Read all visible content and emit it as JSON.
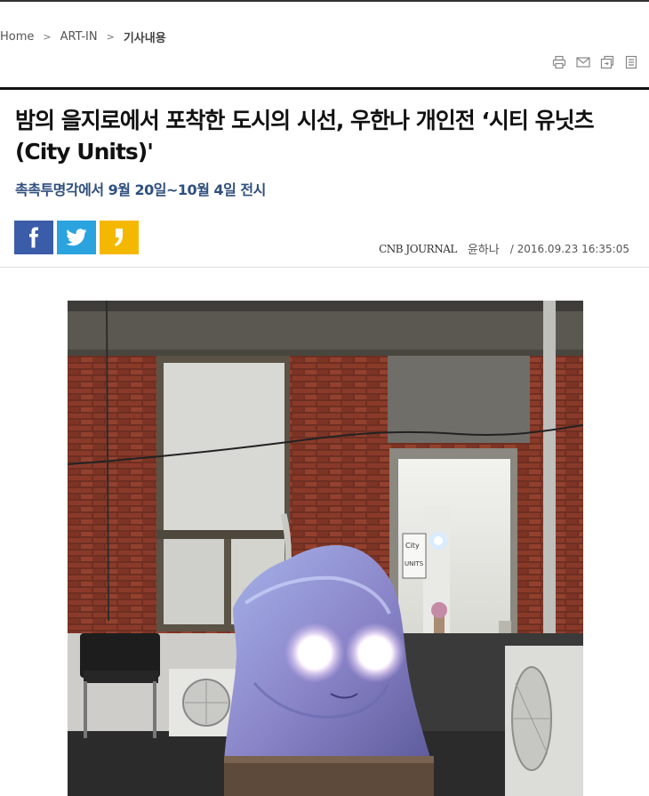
{
  "breadcrumb": {
    "home": "Home",
    "section": "ART-IN",
    "current": "기사내용",
    "separator": ">"
  },
  "tools": {
    "print_icon": "print-icon",
    "email_icon": "email-icon",
    "save_icon": "save-icon",
    "list_icon": "list-icon"
  },
  "article": {
    "title": "밤의 을지로에서 포착한 도시의 시선, 우한나 개인전 ‘시티 유닛츠(City Units)'",
    "subtitle": "촉촉투명각에서 9월 20일~10월 4일 전시",
    "press": "CNB JOURNAL",
    "reporter": "윤하나",
    "date": "/ 2016.09.23 16:35:05",
    "photo_sign_line1": "City",
    "photo_sign_line2": "UNITS"
  },
  "share": {
    "facebook": "f",
    "facebook_icon": "facebook-icon",
    "twitter_icon": "twitter-icon",
    "kakaostory_icon": "kakaostory-icon"
  },
  "colors": {
    "facebook": "#3b5ca8",
    "twitter": "#2aa3df",
    "kakaostory": "#f5b800",
    "subtitle": "#2f4f7f"
  }
}
